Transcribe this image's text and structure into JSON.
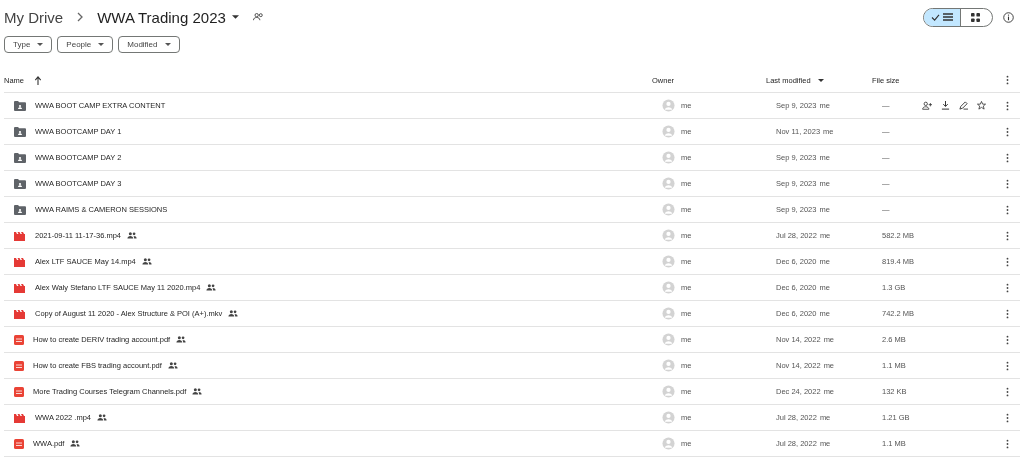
{
  "breadcrumb": [
    {
      "label": "My Drive",
      "current": false
    },
    {
      "label": "WWA Trading 2023",
      "current": true
    }
  ],
  "folder_shared": true,
  "view_toggle": [
    {
      "kind": "list",
      "selected": true
    },
    {
      "kind": "grid",
      "selected": false
    }
  ],
  "filters": [
    {
      "label": "Type"
    },
    {
      "label": "People"
    },
    {
      "label": "Modified"
    }
  ],
  "columns": [
    {
      "label": "Name",
      "sorted": true,
      "dropdown": false
    },
    {
      "label": "Owner",
      "sorted": false,
      "dropdown": false
    },
    {
      "label": "Last modified",
      "sorted": false,
      "dropdown": true
    },
    {
      "label": "File size",
      "sorted": false,
      "dropdown": false
    }
  ],
  "rows": [
    {
      "kind": "folder",
      "name": "WWA BOOT CAMP EXTRA CONTENT",
      "shared": false,
      "owner": "me",
      "modified": "Sep 9, 2023",
      "modified_by": "me",
      "size": "—",
      "hovered": true
    },
    {
      "kind": "folder",
      "name": "WWA BOOTCAMP DAY 1",
      "shared": false,
      "owner": "me",
      "modified": "Nov 11, 2023",
      "modified_by": "me",
      "size": "—",
      "hovered": false
    },
    {
      "kind": "folder",
      "name": "WWA BOOTCAMP DAY 2",
      "shared": false,
      "owner": "me",
      "modified": "Sep 9, 2023",
      "modified_by": "me",
      "size": "—",
      "hovered": false
    },
    {
      "kind": "folder",
      "name": "WWA BOOTCAMP DAY 3",
      "shared": false,
      "owner": "me",
      "modified": "Sep 9, 2023",
      "modified_by": "me",
      "size": "—",
      "hovered": false
    },
    {
      "kind": "folder",
      "name": "WWA RAIMS & CAMERON  SESSIONS",
      "shared": false,
      "owner": "me",
      "modified": "Sep 9, 2023",
      "modified_by": "me",
      "size": "—",
      "hovered": false
    },
    {
      "kind": "video",
      "name": "2021-09-11 11-17-36.mp4",
      "shared": true,
      "owner": "me",
      "modified": "Jul 28, 2022",
      "modified_by": "me",
      "size": "582.2 MB",
      "hovered": false
    },
    {
      "kind": "video",
      "name": "Alex LTF SAUCE May 14.mp4",
      "shared": true,
      "owner": "me",
      "modified": "Dec 6, 2020",
      "modified_by": "me",
      "size": "819.4 MB",
      "hovered": false
    },
    {
      "kind": "video",
      "name": "Alex Waly Stefano LTF SAUCE May 11 2020.mp4",
      "shared": true,
      "owner": "me",
      "modified": "Dec 6, 2020",
      "modified_by": "me",
      "size": "1.3 GB",
      "hovered": false
    },
    {
      "kind": "video",
      "name": "Copy of August 11 2020 - Alex Structure & POI (A+).mkv",
      "shared": true,
      "owner": "me",
      "modified": "Dec 6, 2020",
      "modified_by": "me",
      "size": "742.2 MB",
      "hovered": false
    },
    {
      "kind": "pdf",
      "name": "How to create DERIV trading account.pdf",
      "shared": true,
      "owner": "me",
      "modified": "Nov 14, 2022",
      "modified_by": "me",
      "size": "2.6 MB",
      "hovered": false
    },
    {
      "kind": "pdf",
      "name": "How to create FBS trading account.pdf",
      "shared": true,
      "owner": "me",
      "modified": "Nov 14, 2022",
      "modified_by": "me",
      "size": "1.1 MB",
      "hovered": false
    },
    {
      "kind": "pdf",
      "name": "More Trading Courses Telegram Channels.pdf",
      "shared": true,
      "owner": "me",
      "modified": "Dec 24, 2022",
      "modified_by": "me",
      "size": "132 KB",
      "hovered": false
    },
    {
      "kind": "video",
      "name": "WWA 2022 .mp4",
      "shared": true,
      "owner": "me",
      "modified": "Jul 28, 2022",
      "modified_by": "me",
      "size": "1.21 GB",
      "hovered": false
    },
    {
      "kind": "pdf",
      "name": "WWA.pdf",
      "shared": true,
      "owner": "me",
      "modified": "Jul 28, 2022",
      "modified_by": "me",
      "size": "1.1 MB",
      "hovered": false
    }
  ]
}
